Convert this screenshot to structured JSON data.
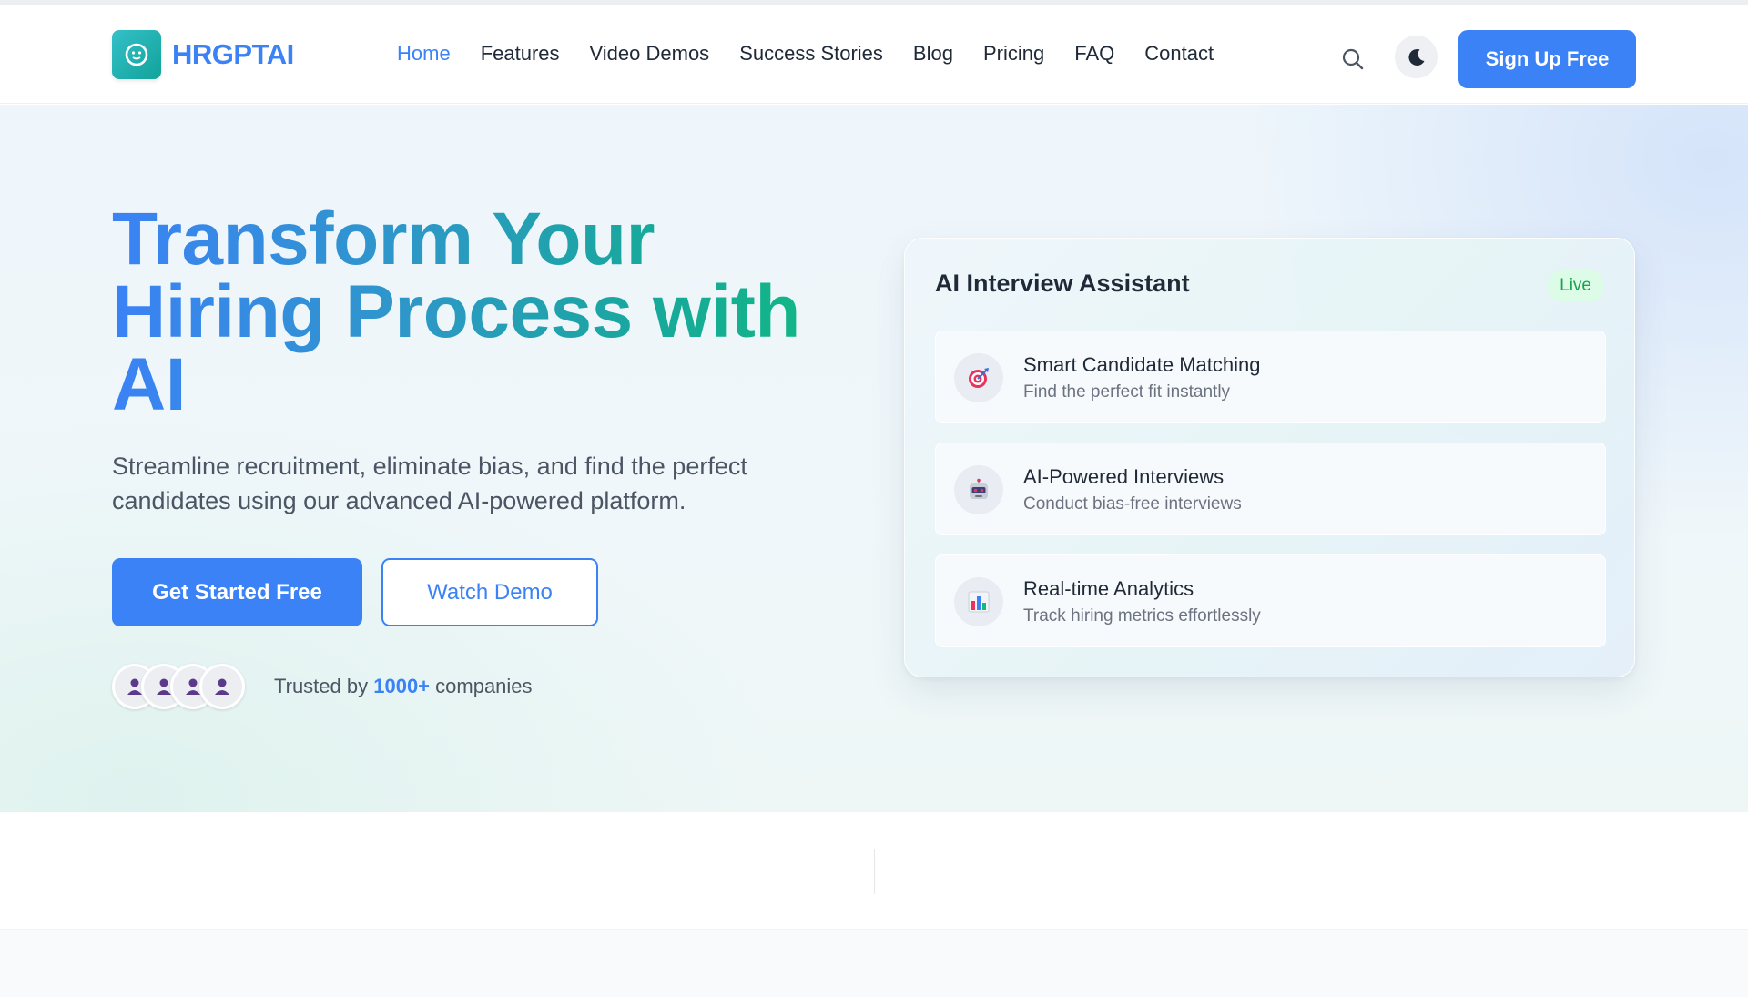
{
  "brand": {
    "name": "HRGPTAI"
  },
  "nav": {
    "items": [
      "Home",
      "Features",
      "Video Demos",
      "Success Stories",
      "Blog",
      "Pricing",
      "FAQ",
      "Contact"
    ],
    "active": "Home",
    "signup_label": "Sign Up Free"
  },
  "hero": {
    "headline": "Transform Your Hiring Process with AI",
    "subtext": "Streamline recruitment, eliminate bias, and find the perfect candidates using our advanced AI-powered platform.",
    "primary_cta": "Get Started Free",
    "secondary_cta": "Watch Demo",
    "trust_prefix": "Trusted by ",
    "trust_count": "1000+",
    "trust_suffix": " companies"
  },
  "card": {
    "title": "AI Interview Assistant",
    "badge": "Live",
    "features": [
      {
        "icon": "target-icon",
        "title": "Smart Candidate Matching",
        "desc": "Find the perfect fit instantly"
      },
      {
        "icon": "robot-icon",
        "title": "AI-Powered Interviews",
        "desc": "Conduct bias-free interviews"
      },
      {
        "icon": "bar-chart-icon",
        "title": "Real-time Analytics",
        "desc": "Track hiring metrics effortlessly"
      }
    ]
  },
  "colors": {
    "accent": "#3b82f6",
    "gradient_end": "#10b981",
    "live_green": "#16a34a"
  }
}
